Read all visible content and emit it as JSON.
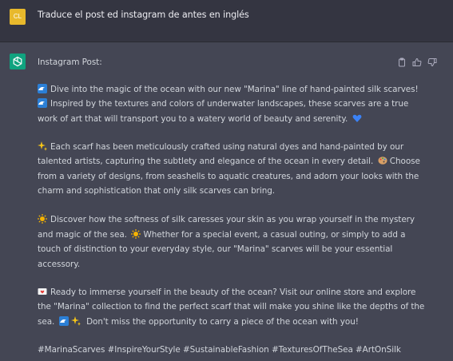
{
  "user": {
    "avatar_text": "CL",
    "message": "Traduce el post ed instagram de antes en inglés"
  },
  "assistant": {
    "heading": "Instagram Post:",
    "icons": [
      "clipboard-icon",
      "thumbs-up-icon",
      "thumbs-down-icon"
    ],
    "lines": [
      "Dive into the magic of the ocean with our new \"Marina\" line of hand-painted silk scarves!",
      "Inspired by the textures and colors of underwater landscapes, these scarves are a true",
      "work of art that will transport you to a watery world of beauty and serenity.",
      "Each scarf has been meticulously crafted using natural dyes and hand-painted by our",
      "talented artists, capturing the subtlety and elegance of the ocean in every detail.",
      "Choose",
      "from a variety of designs, from seashells to aquatic creatures, and adorn your looks with the",
      "charm and sophistication that only silk scarves can bring.",
      "Discover how the softness of silk caresses your skin as you wrap yourself in the mystery",
      "and magic of the sea.",
      "Whether for a special event, a casual outing, or simply to add a",
      "touch of distinction to your everyday style, our \"Marina\" scarves will be your essential",
      "accessory.",
      "Ready to immerse yourself in the beauty of the ocean? Visit our online store and explore",
      "the \"Marina\" collection to find the perfect scarf that will make you shine like the depths of the",
      "sea.",
      "Don't miss the opportunity to carry a piece of the ocean with you!",
      "#MarinaScarves #InspireYourStyle #SustainableFashion #TexturesOfTheSea #ArtOnSilk"
    ]
  },
  "colors": {
    "user_bg": "#343541",
    "assistant_bg": "#444654",
    "user_avatar": "#e8b92c",
    "gpt_avatar": "#10a37f",
    "text": "#d1d5db"
  }
}
